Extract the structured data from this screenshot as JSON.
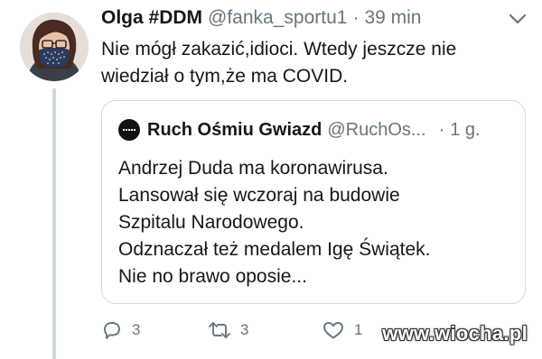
{
  "tweet": {
    "author_name": "Olga #DDM",
    "handle": "@fanka_sportu1",
    "separator": "·",
    "time": "39 min",
    "text_lines": [
      "Nie mógł zakazić,idioci. Wtedy jeszcze nie",
      "wiedział o tym,że ma COVID."
    ]
  },
  "quoted_tweet": {
    "author_name": "Ruch Ośmiu Gwiazd",
    "handle": "@RuchOs...",
    "separator": "·",
    "time": "1 g.",
    "text_lines": [
      "Andrzej Duda ma koronawirusa.",
      "Lansował się wczoraj na budowie",
      "Szpitalu Narodowego.",
      "Odznaczał też medalem Igę Świątek.",
      "Nie no brawo oposie..."
    ]
  },
  "actions": {
    "replies": "3",
    "retweets": "3",
    "likes": "1"
  },
  "watermark": "www.wiocha.pl",
  "colors": {
    "text": "#14171a",
    "secondary": "#66757f",
    "border": "#d2dbe0",
    "thread_line": "#cfd9de"
  }
}
